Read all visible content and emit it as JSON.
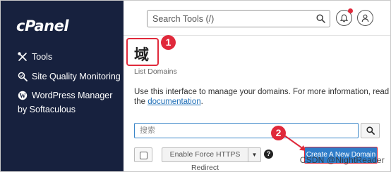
{
  "sidebar": {
    "logo": "cPanel",
    "items": [
      {
        "label": "Tools",
        "icon": "tools-icon"
      },
      {
        "label": "Site Quality Monitoring",
        "icon": "site-quality-icon"
      },
      {
        "label": "WordPress Manager by Softaculous",
        "icon": "wordpress-icon"
      }
    ]
  },
  "topbar": {
    "search_placeholder": "Search Tools (/)",
    "notification_icon": "bell-icon",
    "user_icon": "user-icon"
  },
  "page": {
    "title": "域",
    "subtitle": "List Domains",
    "description_prefix": "Use this interface to manage your domains. For more information, read the",
    "description_link": "documentation",
    "description_suffix": "."
  },
  "toolbar": {
    "filter_placeholder": "搜索",
    "force_https_label": "Enable Force HTTPS Redirect",
    "help_glyph": "?",
    "create_label": "Create A New Domain"
  },
  "annotations": {
    "marker_1": "1",
    "marker_2": "2",
    "watermark": "CSDN @NightReader"
  },
  "colors": {
    "sidebar_bg": "#17213e",
    "accent": "#2f7dc9",
    "annotation_red": "#e0293b"
  }
}
